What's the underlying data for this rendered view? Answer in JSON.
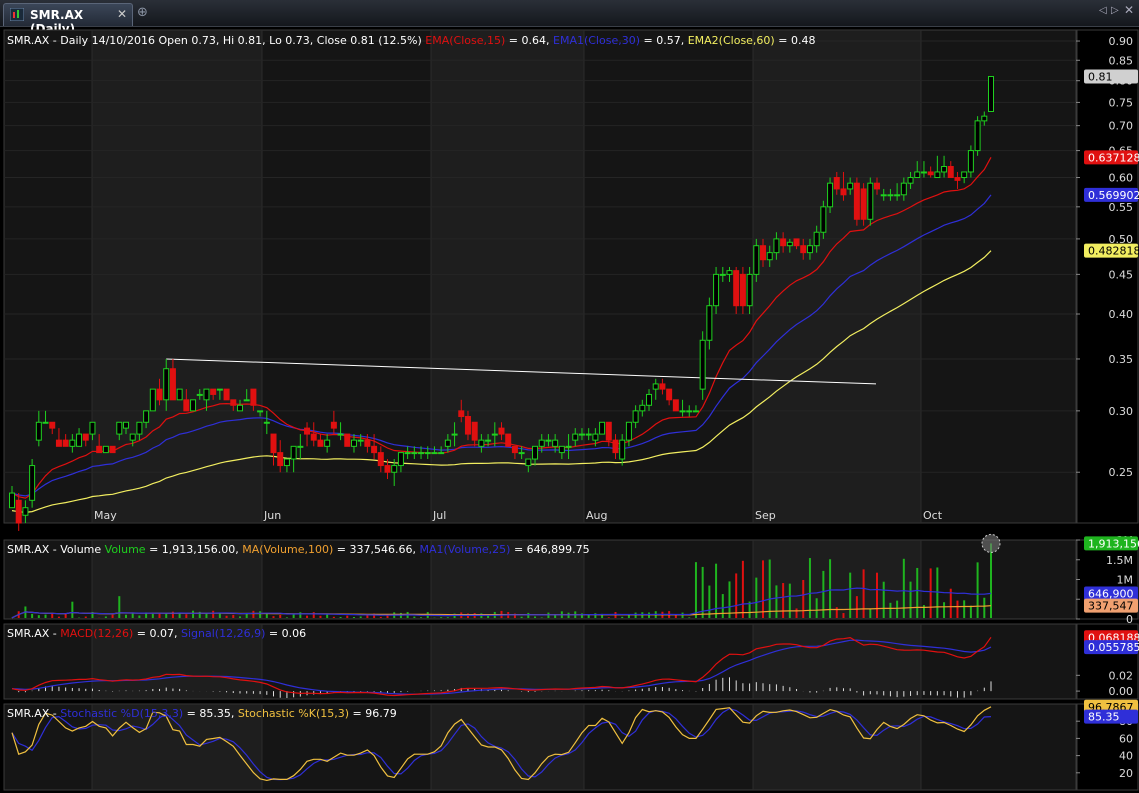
{
  "window": {
    "tab_title": "SMR.AX (Daily)",
    "close_glyph": "✕",
    "new_tab_glyph": "⊕",
    "nav_prev_glyph": "◁",
    "nav_next_glyph": "▷",
    "nav_close_glyph": "✕"
  },
  "colors": {
    "up": "#1fd01f",
    "down": "#e01010",
    "ema15": "#e01010",
    "ema30": "#2f2fd8",
    "ema60": "#f2ee60",
    "volume": "#1fb41f",
    "macd": "#e01010",
    "signal": "#2f2fd8",
    "stoch_d": "#2f2fd8",
    "stoch_k": "#f0c040",
    "trendline": "#ffffff"
  },
  "chart_data": [
    {
      "type": "candlestick",
      "title": "SMR.AX - Daily 14/10/2016 Open 0.73, Hi 0.81, Lo 0.73, Close 0.81 (12.5%)",
      "legend": [
        {
          "label": "EMA(Close,15)",
          "value": " = 0.64,"
        },
        {
          "label": "EMA1(Close,30)",
          "value": " = 0.57,"
        },
        {
          "label": "EMA2(Close,60)",
          "value": " = 0.48"
        }
      ],
      "y_scale": "log",
      "ylim": [
        0.215,
        0.93
      ],
      "y_ticks": [
        "0.90",
        "0.85",
        "0.80",
        "0.75",
        "0.70",
        "0.65",
        "0.60",
        "0.55",
        "0.50",
        "0.45",
        "0.40",
        "0.35",
        "0.30",
        "0.25"
      ],
      "x_labels": [
        "May",
        "Jun",
        "Jul",
        "Aug",
        "Sep",
        "Oct"
      ],
      "value_labels": [
        "0.81",
        "0.637128",
        "0.569902",
        "0.482818"
      ],
      "candles_ohlc": [
        [
          0.225,
          0.24,
          0.225,
          0.235
        ],
        [
          0.23,
          0.235,
          0.21,
          0.215
        ],
        [
          0.22,
          0.23,
          0.215,
          0.225
        ],
        [
          0.23,
          0.26,
          0.225,
          0.255
        ],
        [
          0.275,
          0.3,
          0.27,
          0.29
        ],
        [
          0.29,
          0.3,
          0.29,
          0.29
        ],
        [
          0.29,
          0.29,
          0.28,
          0.285
        ],
        [
          0.275,
          0.285,
          0.27,
          0.27
        ],
        [
          0.275,
          0.28,
          0.27,
          0.27
        ],
        [
          0.27,
          0.28,
          0.265,
          0.275
        ],
        [
          0.27,
          0.285,
          0.27,
          0.28
        ],
        [
          0.28,
          0.28,
          0.27,
          0.275
        ],
        [
          0.28,
          0.29,
          0.275,
          0.29
        ],
        [
          0.27,
          0.28,
          0.265,
          0.265
        ],
        [
          0.265,
          0.27,
          0.265,
          0.27
        ],
        [
          0.27,
          0.27,
          0.265,
          0.265
        ],
        [
          0.28,
          0.29,
          0.275,
          0.29
        ],
        [
          0.285,
          0.29,
          0.28,
          0.29
        ],
        [
          0.275,
          0.28,
          0.27,
          0.28
        ],
        [
          0.28,
          0.29,
          0.275,
          0.29
        ],
        [
          0.29,
          0.3,
          0.285,
          0.3
        ],
        [
          0.3,
          0.32,
          0.3,
          0.32
        ],
        [
          0.32,
          0.33,
          0.305,
          0.31
        ],
        [
          0.31,
          0.35,
          0.3,
          0.34
        ],
        [
          0.34,
          0.35,
          0.31,
          0.31
        ],
        [
          0.31,
          0.32,
          0.31,
          0.32
        ],
        [
          0.31,
          0.32,
          0.3,
          0.3
        ],
        [
          0.3,
          0.31,
          0.3,
          0.31
        ],
        [
          0.315,
          0.32,
          0.31,
          0.315
        ],
        [
          0.31,
          0.32,
          0.3,
          0.32
        ],
        [
          0.32,
          0.32,
          0.31,
          0.315
        ],
        [
          0.32,
          0.32,
          0.31,
          0.32
        ],
        [
          0.32,
          0.32,
          0.31,
          0.31
        ],
        [
          0.31,
          0.31,
          0.3,
          0.305
        ],
        [
          0.3,
          0.31,
          0.3,
          0.305
        ],
        [
          0.31,
          0.32,
          0.31,
          0.31
        ],
        [
          0.32,
          0.32,
          0.3,
          0.305
        ],
        [
          0.3,
          0.3,
          0.295,
          0.3
        ],
        [
          0.29,
          0.3,
          0.28,
          0.29
        ],
        [
          0.28,
          0.28,
          0.255,
          0.265
        ],
        [
          0.265,
          0.275,
          0.25,
          0.255
        ],
        [
          0.255,
          0.26,
          0.25,
          0.26
        ],
        [
          0.26,
          0.27,
          0.25,
          0.27
        ],
        [
          0.27,
          0.28,
          0.26,
          0.27
        ],
        [
          0.285,
          0.29,
          0.27,
          0.28
        ],
        [
          0.28,
          0.29,
          0.27,
          0.275
        ],
        [
          0.275,
          0.28,
          0.27,
          0.27
        ],
        [
          0.27,
          0.28,
          0.265,
          0.275
        ],
        [
          0.29,
          0.3,
          0.28,
          0.285
        ],
        [
          0.28,
          0.29,
          0.275,
          0.28
        ],
        [
          0.28,
          0.28,
          0.27,
          0.27
        ],
        [
          0.27,
          0.28,
          0.265,
          0.275
        ],
        [
          0.275,
          0.28,
          0.27,
          0.275
        ],
        [
          0.275,
          0.28,
          0.265,
          0.27
        ],
        [
          0.27,
          0.28,
          0.26,
          0.265
        ],
        [
          0.265,
          0.27,
          0.25,
          0.255
        ],
        [
          0.255,
          0.26,
          0.245,
          0.25
        ],
        [
          0.25,
          0.26,
          0.24,
          0.255
        ],
        [
          0.255,
          0.265,
          0.25,
          0.265
        ],
        [
          0.265,
          0.27,
          0.26,
          0.265
        ],
        [
          0.265,
          0.27,
          0.26,
          0.265
        ],
        [
          0.265,
          0.27,
          0.26,
          0.265
        ],
        [
          0.265,
          0.27,
          0.26,
          0.265
        ],
        [
          0.265,
          0.27,
          0.265,
          0.265
        ],
        [
          0.265,
          0.27,
          0.265,
          0.265
        ],
        [
          0.27,
          0.28,
          0.265,
          0.275
        ],
        [
          0.28,
          0.29,
          0.27,
          0.28
        ],
        [
          0.3,
          0.31,
          0.29,
          0.295
        ],
        [
          0.295,
          0.3,
          0.275,
          0.28
        ],
        [
          0.29,
          0.29,
          0.27,
          0.275
        ],
        [
          0.27,
          0.28,
          0.265,
          0.275
        ],
        [
          0.275,
          0.28,
          0.27,
          0.275
        ],
        [
          0.28,
          0.29,
          0.27,
          0.28
        ],
        [
          0.285,
          0.29,
          0.275,
          0.28
        ],
        [
          0.28,
          0.28,
          0.27,
          0.27
        ],
        [
          0.27,
          0.27,
          0.26,
          0.265
        ],
        [
          0.265,
          0.27,
          0.26,
          0.265
        ],
        [
          0.255,
          0.26,
          0.25,
          0.26
        ],
        [
          0.26,
          0.27,
          0.255,
          0.27
        ],
        [
          0.27,
          0.28,
          0.265,
          0.275
        ],
        [
          0.275,
          0.28,
          0.27,
          0.275
        ],
        [
          0.27,
          0.28,
          0.265,
          0.275
        ],
        [
          0.265,
          0.27,
          0.26,
          0.27
        ],
        [
          0.27,
          0.28,
          0.26,
          0.27
        ],
        [
          0.275,
          0.285,
          0.27,
          0.28
        ],
        [
          0.28,
          0.285,
          0.275,
          0.28
        ],
        [
          0.28,
          0.285,
          0.275,
          0.28
        ],
        [
          0.275,
          0.285,
          0.27,
          0.28
        ],
        [
          0.28,
          0.29,
          0.28,
          0.29
        ],
        [
          0.29,
          0.29,
          0.27,
          0.275
        ],
        [
          0.275,
          0.28,
          0.26,
          0.265
        ],
        [
          0.26,
          0.28,
          0.255,
          0.275
        ],
        [
          0.275,
          0.29,
          0.27,
          0.29
        ],
        [
          0.29,
          0.305,
          0.285,
          0.3
        ],
        [
          0.3,
          0.31,
          0.295,
          0.305
        ],
        [
          0.305,
          0.32,
          0.3,
          0.315
        ],
        [
          0.32,
          0.33,
          0.31,
          0.325
        ],
        [
          0.325,
          0.33,
          0.315,
          0.32
        ],
        [
          0.32,
          0.32,
          0.305,
          0.31
        ],
        [
          0.31,
          0.31,
          0.3,
          0.3
        ],
        [
          0.3,
          0.31,
          0.295,
          0.3
        ],
        [
          0.3,
          0.305,
          0.295,
          0.3
        ],
        [
          0.3,
          0.305,
          0.3,
          0.3
        ],
        [
          0.32,
          0.38,
          0.31,
          0.37
        ],
        [
          0.37,
          0.42,
          0.36,
          0.41
        ],
        [
          0.41,
          0.46,
          0.4,
          0.45
        ],
        [
          0.45,
          0.46,
          0.44,
          0.45
        ],
        [
          0.45,
          0.46,
          0.44,
          0.455
        ],
        [
          0.455,
          0.46,
          0.4,
          0.41
        ],
        [
          0.45,
          0.46,
          0.4,
          0.41
        ],
        [
          0.41,
          0.46,
          0.4,
          0.45
        ],
        [
          0.45,
          0.5,
          0.44,
          0.49
        ],
        [
          0.49,
          0.5,
          0.46,
          0.47
        ],
        [
          0.47,
          0.49,
          0.46,
          0.48
        ],
        [
          0.48,
          0.51,
          0.47,
          0.5
        ],
        [
          0.5,
          0.51,
          0.48,
          0.49
        ],
        [
          0.49,
          0.5,
          0.48,
          0.495
        ],
        [
          0.5,
          0.5,
          0.485,
          0.49
        ],
        [
          0.49,
          0.5,
          0.47,
          0.48
        ],
        [
          0.48,
          0.5,
          0.47,
          0.49
        ],
        [
          0.49,
          0.52,
          0.48,
          0.51
        ],
        [
          0.51,
          0.56,
          0.5,
          0.55
        ],
        [
          0.55,
          0.6,
          0.54,
          0.59
        ],
        [
          0.6,
          0.61,
          0.57,
          0.58
        ],
        [
          0.58,
          0.61,
          0.56,
          0.57
        ],
        [
          0.58,
          0.6,
          0.57,
          0.59
        ],
        [
          0.59,
          0.6,
          0.52,
          0.53
        ],
        [
          0.58,
          0.59,
          0.52,
          0.53
        ],
        [
          0.53,
          0.6,
          0.52,
          0.59
        ],
        [
          0.59,
          0.6,
          0.57,
          0.58
        ],
        [
          0.57,
          0.58,
          0.56,
          0.57
        ],
        [
          0.57,
          0.58,
          0.56,
          0.57
        ],
        [
          0.57,
          0.59,
          0.56,
          0.57
        ],
        [
          0.57,
          0.6,
          0.56,
          0.59
        ],
        [
          0.59,
          0.61,
          0.58,
          0.6
        ],
        [
          0.6,
          0.63,
          0.6,
          0.61
        ],
        [
          0.61,
          0.63,
          0.6,
          0.61
        ],
        [
          0.61,
          0.62,
          0.6,
          0.605
        ],
        [
          0.6,
          0.64,
          0.6,
          0.61
        ],
        [
          0.61,
          0.64,
          0.6,
          0.62
        ],
        [
          0.62,
          0.63,
          0.6,
          0.6
        ],
        [
          0.6,
          0.61,
          0.58,
          0.595
        ],
        [
          0.6,
          0.61,
          0.59,
          0.61
        ],
        [
          0.61,
          0.66,
          0.6,
          0.65
        ],
        [
          0.65,
          0.72,
          0.64,
          0.71
        ],
        [
          0.71,
          0.73,
          0.7,
          0.72
        ],
        [
          0.73,
          0.81,
          0.73,
          0.81
        ]
      ],
      "ema_ends": {
        "ema15": 0.637128,
        "ema30": 0.569902,
        "ema60": 0.482818
      }
    },
    {
      "type": "bar",
      "title": "SMR.AX - Volume",
      "legend": [
        {
          "label": "Volume",
          "value": " = 1,913,156.00,"
        },
        {
          "label": "MA(Volume,100)",
          "value": " = 337,546.66,"
        },
        {
          "label": "MA1(Volume,25)",
          "value": " = 646,899.75"
        }
      ],
      "y_ticks": [
        "2M",
        "1.5M",
        "1M",
        "500K",
        "0"
      ],
      "ylim": [
        0,
        2000000
      ],
      "value_labels": [
        "1,913,156",
        "646,900",
        "337,547"
      ],
      "last_values": {
        "volume": 1913156,
        "ma100": 337546.66,
        "ma25": 646899.75
      }
    },
    {
      "type": "line",
      "title": "SMR.AX -",
      "legend": [
        {
          "label": "MACD(12,26)",
          "value": " = 0.07,"
        },
        {
          "label": "Signal(12,26,9)",
          "value": " = 0.06"
        }
      ],
      "y_ticks": [
        "0.02",
        "0.00"
      ],
      "ylim": [
        -0.01,
        0.085
      ],
      "value_labels": [
        "0.068188",
        "0.055785"
      ],
      "last_values": {
        "macd": 0.068188,
        "signal": 0.055785
      }
    },
    {
      "type": "line",
      "title": "SMR.AX -",
      "legend": [
        {
          "label": "Stochastic %D(15,3,3)",
          "value": " = 85.35,"
        },
        {
          "label": "Stochastic %K(15,3)",
          "value": " = 96.79"
        }
      ],
      "y_ticks": [
        "80",
        "60",
        "40",
        "20"
      ],
      "ylim": [
        0,
        100
      ],
      "value_labels": [
        "96.7867",
        "85.35"
      ],
      "last_values": {
        "d": 85.35,
        "k": 96.7867
      }
    }
  ]
}
